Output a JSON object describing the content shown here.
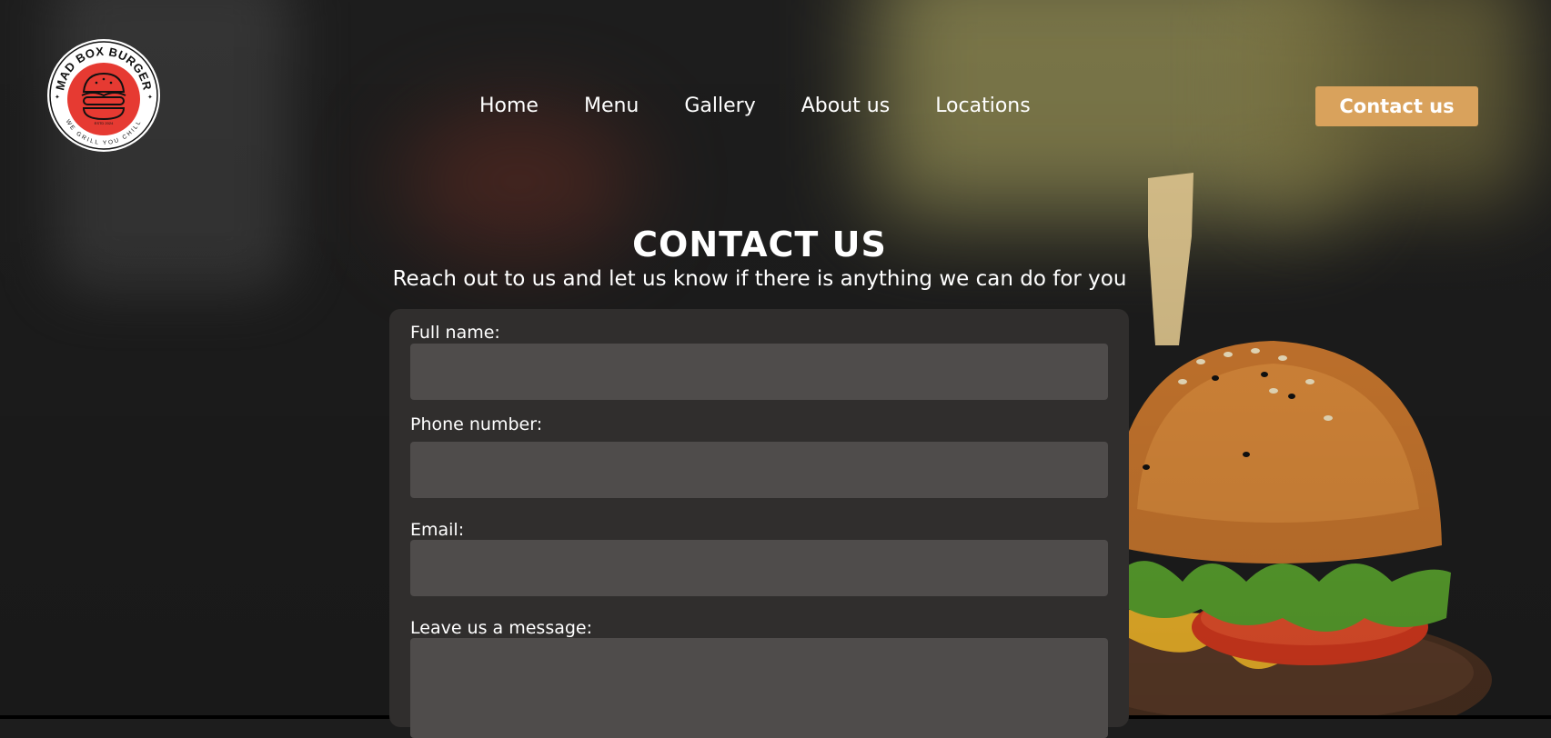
{
  "brand": {
    "logo_text_top": "MAD BOX BURGER",
    "logo_text_bottom": "WE GRILL YOU CHILL",
    "logo_est": "ESTD 2024",
    "colors": {
      "logo_red": "#e63a32",
      "ring": "#ffffff"
    }
  },
  "nav": {
    "items": [
      {
        "label": "Home"
      },
      {
        "label": "Menu"
      },
      {
        "label": "Gallery"
      },
      {
        "label": "About us"
      },
      {
        "label": "Locations"
      }
    ],
    "cta_label": "Contact us"
  },
  "hero": {
    "title": "CONTACT US",
    "subtitle": "Reach out to us and let us know if there is anything we can do for you"
  },
  "form": {
    "fields": [
      {
        "label": "Full name:",
        "value": ""
      },
      {
        "label": "Phone number:",
        "value": ""
      },
      {
        "label": "Email:",
        "value": ""
      },
      {
        "label": "Leave us a message:",
        "value": ""
      }
    ]
  },
  "colors": {
    "accent": "#d9a25c",
    "card": "#302e2d",
    "input": "#4f4c4b",
    "background": "#1d1d1d"
  }
}
